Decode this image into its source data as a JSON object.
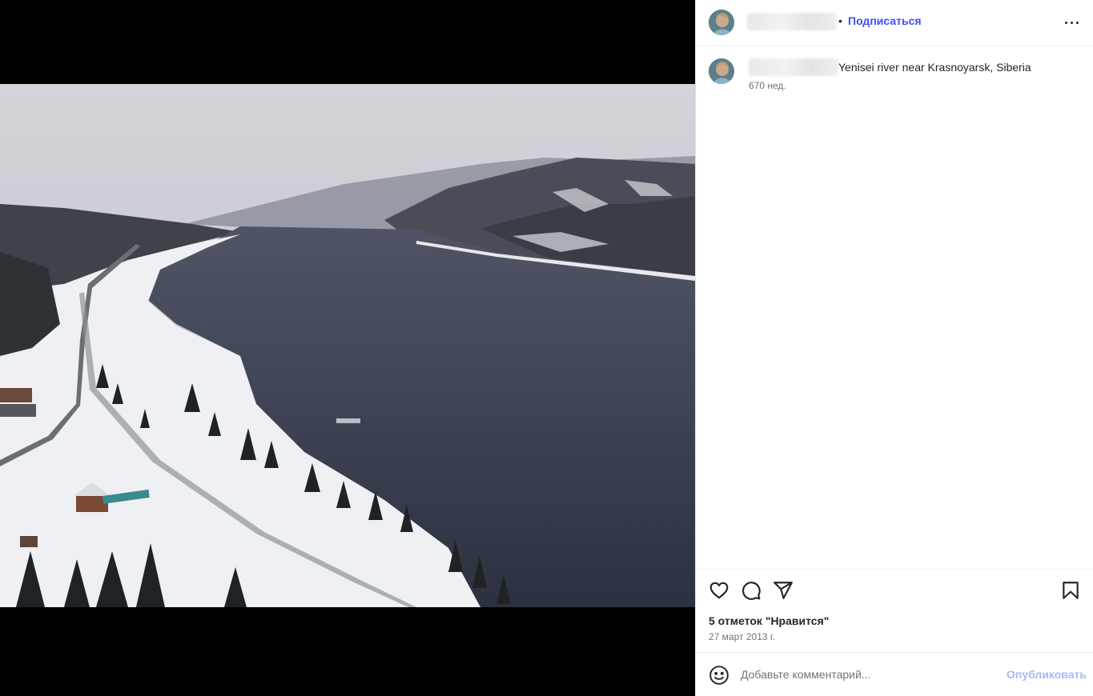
{
  "header": {
    "follow_label": "Подписаться",
    "dot": "•",
    "more_icon": "more-horizontal-icon"
  },
  "caption": {
    "text": "Yenisei river near Krasnoyarsk, Siberia",
    "time": "670 нед."
  },
  "actions": {
    "like_icon": "heart-icon",
    "comment_icon": "comment-icon",
    "share_icon": "send-icon",
    "save_icon": "bookmark-icon",
    "likes": "5 отметок \"Нравится\"",
    "date": "27 март 2013 г."
  },
  "comment": {
    "placeholder": "Добавьте комментарий...",
    "publish_label": "Опубликовать",
    "emoji_icon": "smiley-icon"
  },
  "colors": {
    "accent": "#4150f7",
    "publish_disabled": "#a8b9f5",
    "text_primary": "#262626",
    "text_secondary": "#737373"
  }
}
